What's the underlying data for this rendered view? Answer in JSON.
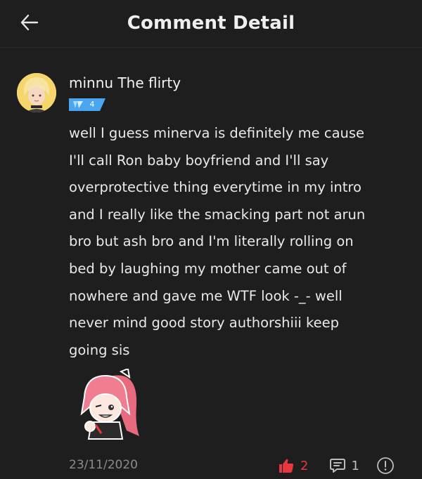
{
  "header": {
    "title": "Comment Detail",
    "back_icon": "arrow-left-icon"
  },
  "comment": {
    "author": "minnu The flirty",
    "level": "4",
    "lines": [
      "well I guess minerva is definitely me cause",
      "I'll call Ron baby boyfriend and I'll say",
      "overprotective thing everytime in my intro",
      "and I really like the smacking part not arun",
      "bro but ash bro and I'm literally rolling on",
      "bed by laughing my mother came out of",
      "nowhere and gave me WTF look -_- well",
      "never mind good story authorshiii keep",
      "going sis"
    ],
    "date": "23/11/2020",
    "likes": "2",
    "replies": "1"
  },
  "colors": {
    "background": "#1e1e1e",
    "like_accent": "#e8373e",
    "level_badge": "#4aa6f0"
  }
}
